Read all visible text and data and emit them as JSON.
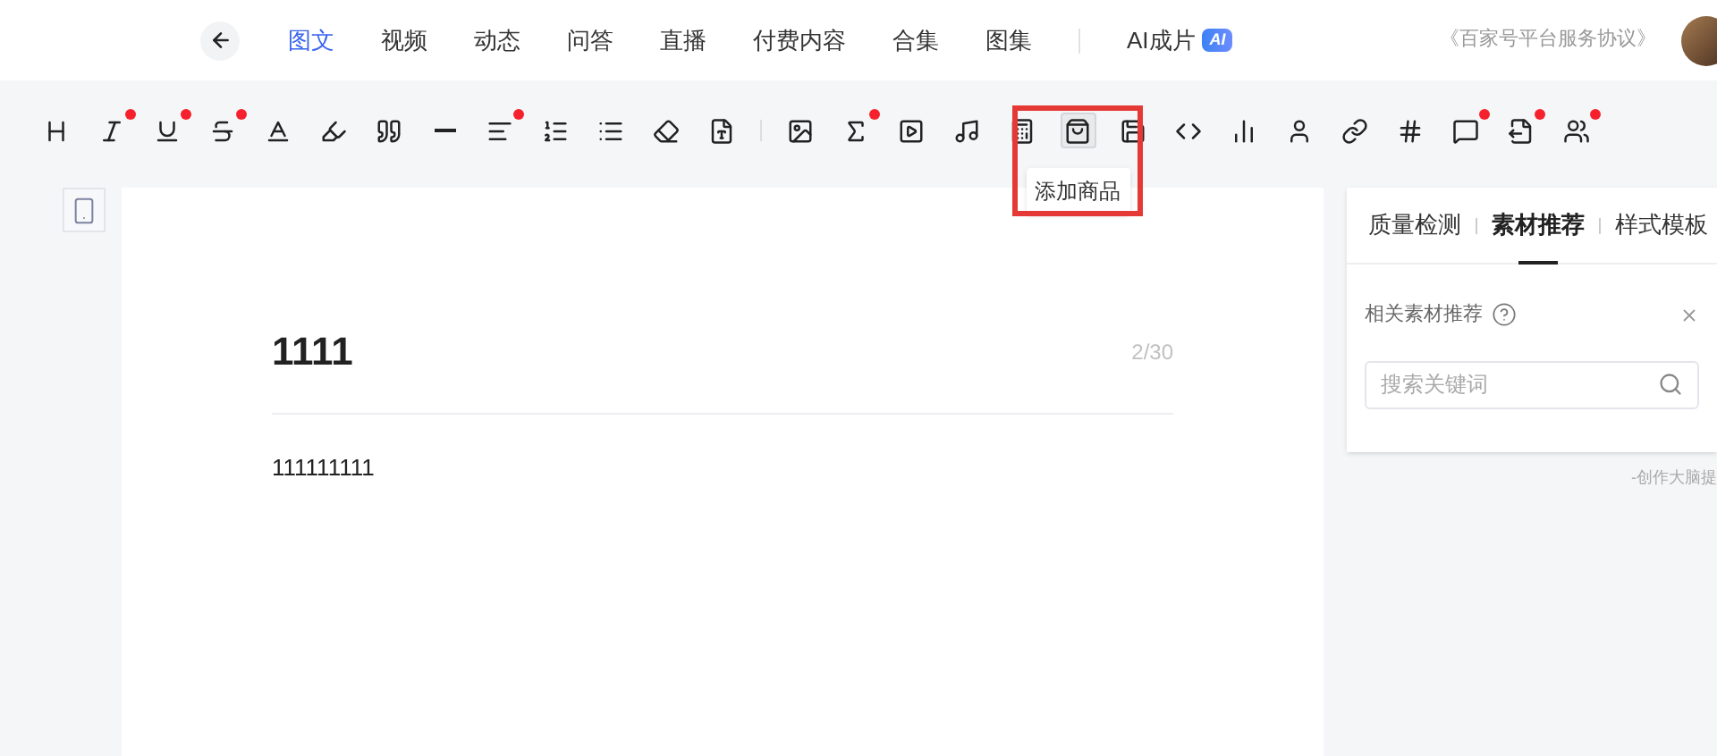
{
  "nav": {
    "tabs": [
      {
        "label": "图文",
        "selected": true
      },
      {
        "label": "视频",
        "selected": false
      },
      {
        "label": "动态",
        "selected": false
      },
      {
        "label": "问答",
        "selected": false
      },
      {
        "label": "直播",
        "selected": false
      },
      {
        "label": "付费内容",
        "selected": false
      },
      {
        "label": "合集",
        "selected": false
      },
      {
        "label": "图集",
        "selected": false
      }
    ],
    "ai_tab": {
      "label": "AI成片",
      "badge": "AI",
      "selected": false
    },
    "agreement_link": "《百家号平台服务协议》"
  },
  "toolbar": [
    {
      "kind": "heading",
      "dot": false,
      "selected": false
    },
    {
      "kind": "italic",
      "dot": true,
      "selected": false
    },
    {
      "kind": "underline",
      "dot": true,
      "selected": false
    },
    {
      "kind": "strike",
      "dot": true,
      "selected": false
    },
    {
      "kind": "font-color",
      "dot": false,
      "selected": false
    },
    {
      "kind": "highlight",
      "dot": false,
      "selected": false
    },
    {
      "kind": "quote",
      "dot": false,
      "selected": false
    },
    {
      "kind": "rule",
      "dot": false,
      "selected": false
    },
    {
      "kind": "align",
      "dot": true,
      "selected": false
    },
    {
      "kind": "ordered-list",
      "dot": false,
      "selected": false
    },
    {
      "kind": "bullet-list",
      "dot": false,
      "selected": false
    },
    {
      "kind": "eraser",
      "dot": false,
      "selected": false
    },
    {
      "kind": "format",
      "dot": false,
      "selected": false
    },
    {
      "kind": "divider"
    },
    {
      "kind": "image",
      "dot": false,
      "selected": false
    },
    {
      "kind": "formula",
      "dot": true,
      "selected": false
    },
    {
      "kind": "video",
      "dot": false,
      "selected": false
    },
    {
      "kind": "music",
      "dot": false,
      "selected": false
    },
    {
      "kind": "calculator",
      "dot": false,
      "selected": false
    },
    {
      "kind": "bag",
      "dot": false,
      "selected": true,
      "tooltip": "添加商品"
    },
    {
      "kind": "save",
      "dot": false,
      "selected": false
    },
    {
      "kind": "code",
      "dot": false,
      "selected": false
    },
    {
      "kind": "chart",
      "dot": false,
      "selected": false
    },
    {
      "kind": "person",
      "dot": false,
      "selected": false
    },
    {
      "kind": "link",
      "dot": false,
      "selected": false
    },
    {
      "kind": "hash",
      "dot": false,
      "selected": false
    },
    {
      "kind": "flag",
      "dot": true,
      "selected": false
    },
    {
      "kind": "export",
      "dot": true,
      "selected": false
    },
    {
      "kind": "users",
      "dot": true,
      "selected": false
    }
  ],
  "editor": {
    "title": "1111",
    "title_count": "2/30",
    "body": "111111111"
  },
  "side_panel": {
    "tabs": [
      {
        "label": "质量检测",
        "selected": false
      },
      {
        "label": "素材推荐",
        "selected": true
      },
      {
        "label": "样式模板",
        "selected": false
      }
    ],
    "section_title": "相关素材推荐",
    "search": {
      "placeholder": "搜索关键词"
    },
    "footer": "-创作大脑提"
  }
}
